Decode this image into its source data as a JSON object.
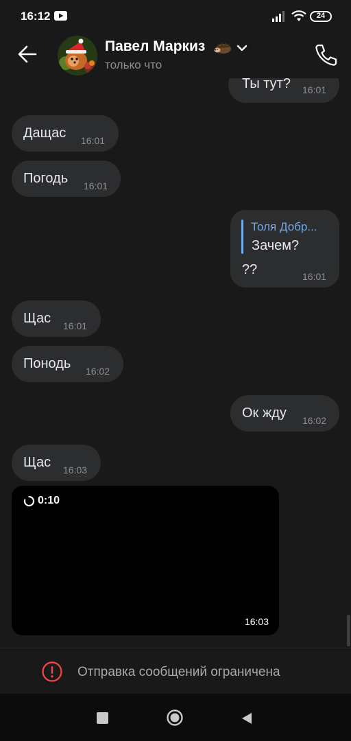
{
  "status_bar": {
    "time": "16:12",
    "battery": "24"
  },
  "header": {
    "contact_name": "Павел Маркиз",
    "status": "только что"
  },
  "messages": [
    {
      "side": "out",
      "text": "Ты тут?",
      "time": "16:01"
    },
    {
      "side": "in",
      "text": "Дащас",
      "time": "16:01"
    },
    {
      "side": "in",
      "text": "Погодь",
      "time": "16:01"
    },
    {
      "side": "out",
      "reply_to": "Толя Добр...",
      "text_line1": "Зачем?",
      "text_line2": "??",
      "time": "16:01"
    },
    {
      "side": "in",
      "text": "Щас",
      "time": "16:01"
    },
    {
      "side": "in",
      "text": "Понодь",
      "time": "16:02"
    },
    {
      "side": "out",
      "text": "Ок жду",
      "time": "16:02"
    },
    {
      "side": "in",
      "text": "Щас",
      "time": "16:03"
    },
    {
      "side": "in",
      "type": "video",
      "duration": "0:10",
      "time": "16:03"
    }
  ],
  "restriction": {
    "text": "Отправка сообщений ограничена"
  },
  "colors": {
    "background": "#19191a",
    "bubble": "#2c2d2e",
    "accent": "#71aaeb",
    "alert": "#e64646"
  },
  "icons": [
    "back-arrow-icon",
    "chevron-down-icon",
    "phone-icon",
    "alert-icon",
    "loading-icon",
    "stop-square-icon",
    "home-circle-icon",
    "back-triangle-icon"
  ]
}
